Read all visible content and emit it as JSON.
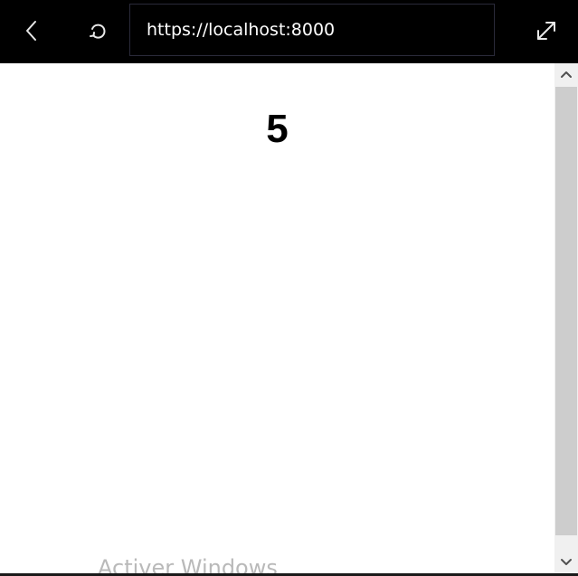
{
  "toolbar": {
    "back_icon": "chevron-left-icon",
    "reload_icon": "reload-icon",
    "expand_icon": "expand-icon",
    "url_value": "https://localhost:8000",
    "background_color": "#000000",
    "text_color": "#ffffff"
  },
  "page": {
    "number": "5"
  },
  "scrollbar": {
    "up_icon": "chevron-up-icon",
    "down_icon": "chevron-down-icon"
  },
  "watermark": {
    "text": "Activer Windows"
  }
}
